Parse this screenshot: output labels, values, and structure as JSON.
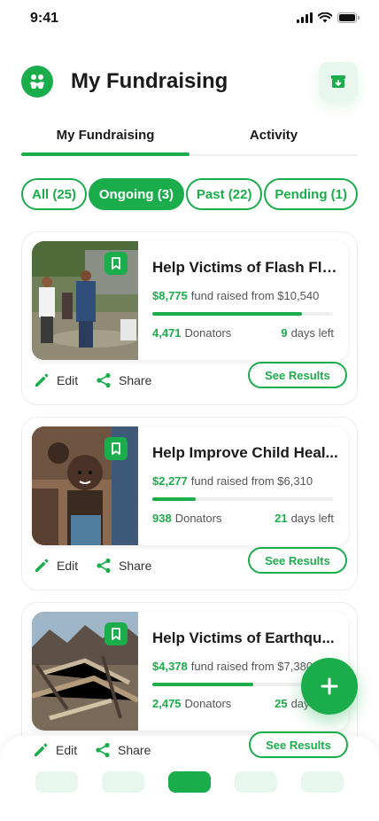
{
  "status_bar": {
    "time": "9:41"
  },
  "header": {
    "title": "My Fundraising"
  },
  "tabs": [
    {
      "label": "My Fundraising"
    },
    {
      "label": "Activity"
    }
  ],
  "filters": [
    {
      "label": "All (25)"
    },
    {
      "label": "Ongoing (3)"
    },
    {
      "label": "Past (22)"
    },
    {
      "label": "Pending (1)"
    }
  ],
  "cards": [
    {
      "title": "Help Victims of Flash Flo...",
      "raised": "$8,775",
      "raised_text": "fund raised from $10,540",
      "progress": 0.83,
      "donators": "4,471",
      "donators_label": "Donators",
      "days": "9",
      "days_label": "days left"
    },
    {
      "title": "Help Improve Child Heal...",
      "raised": "$2,277",
      "raised_text": "fund raised from $6,310",
      "progress": 0.24,
      "donators": "938",
      "donators_label": "Donators",
      "days": "21",
      "days_label": "days left"
    },
    {
      "title": "Help Victims of Earthqu...",
      "raised": "$4,378",
      "raised_text": "fund raised from $7,380",
      "progress": 0.56,
      "donators": "2,475",
      "donators_label": "Donators",
      "days": "25",
      "days_label": "days left"
    }
  ],
  "card_actions": {
    "edit": "Edit",
    "share": "Share",
    "results": "See Results"
  },
  "colors": {
    "primary": "#1bac4b",
    "primary_light": "#e8f7ee"
  },
  "icons": [
    "logo-icon",
    "archive-icon",
    "bookmark-icon",
    "edit-icon",
    "share-icon",
    "plus-icon",
    "home-icon",
    "list-icon",
    "chat-icon",
    "profile-icon"
  ]
}
